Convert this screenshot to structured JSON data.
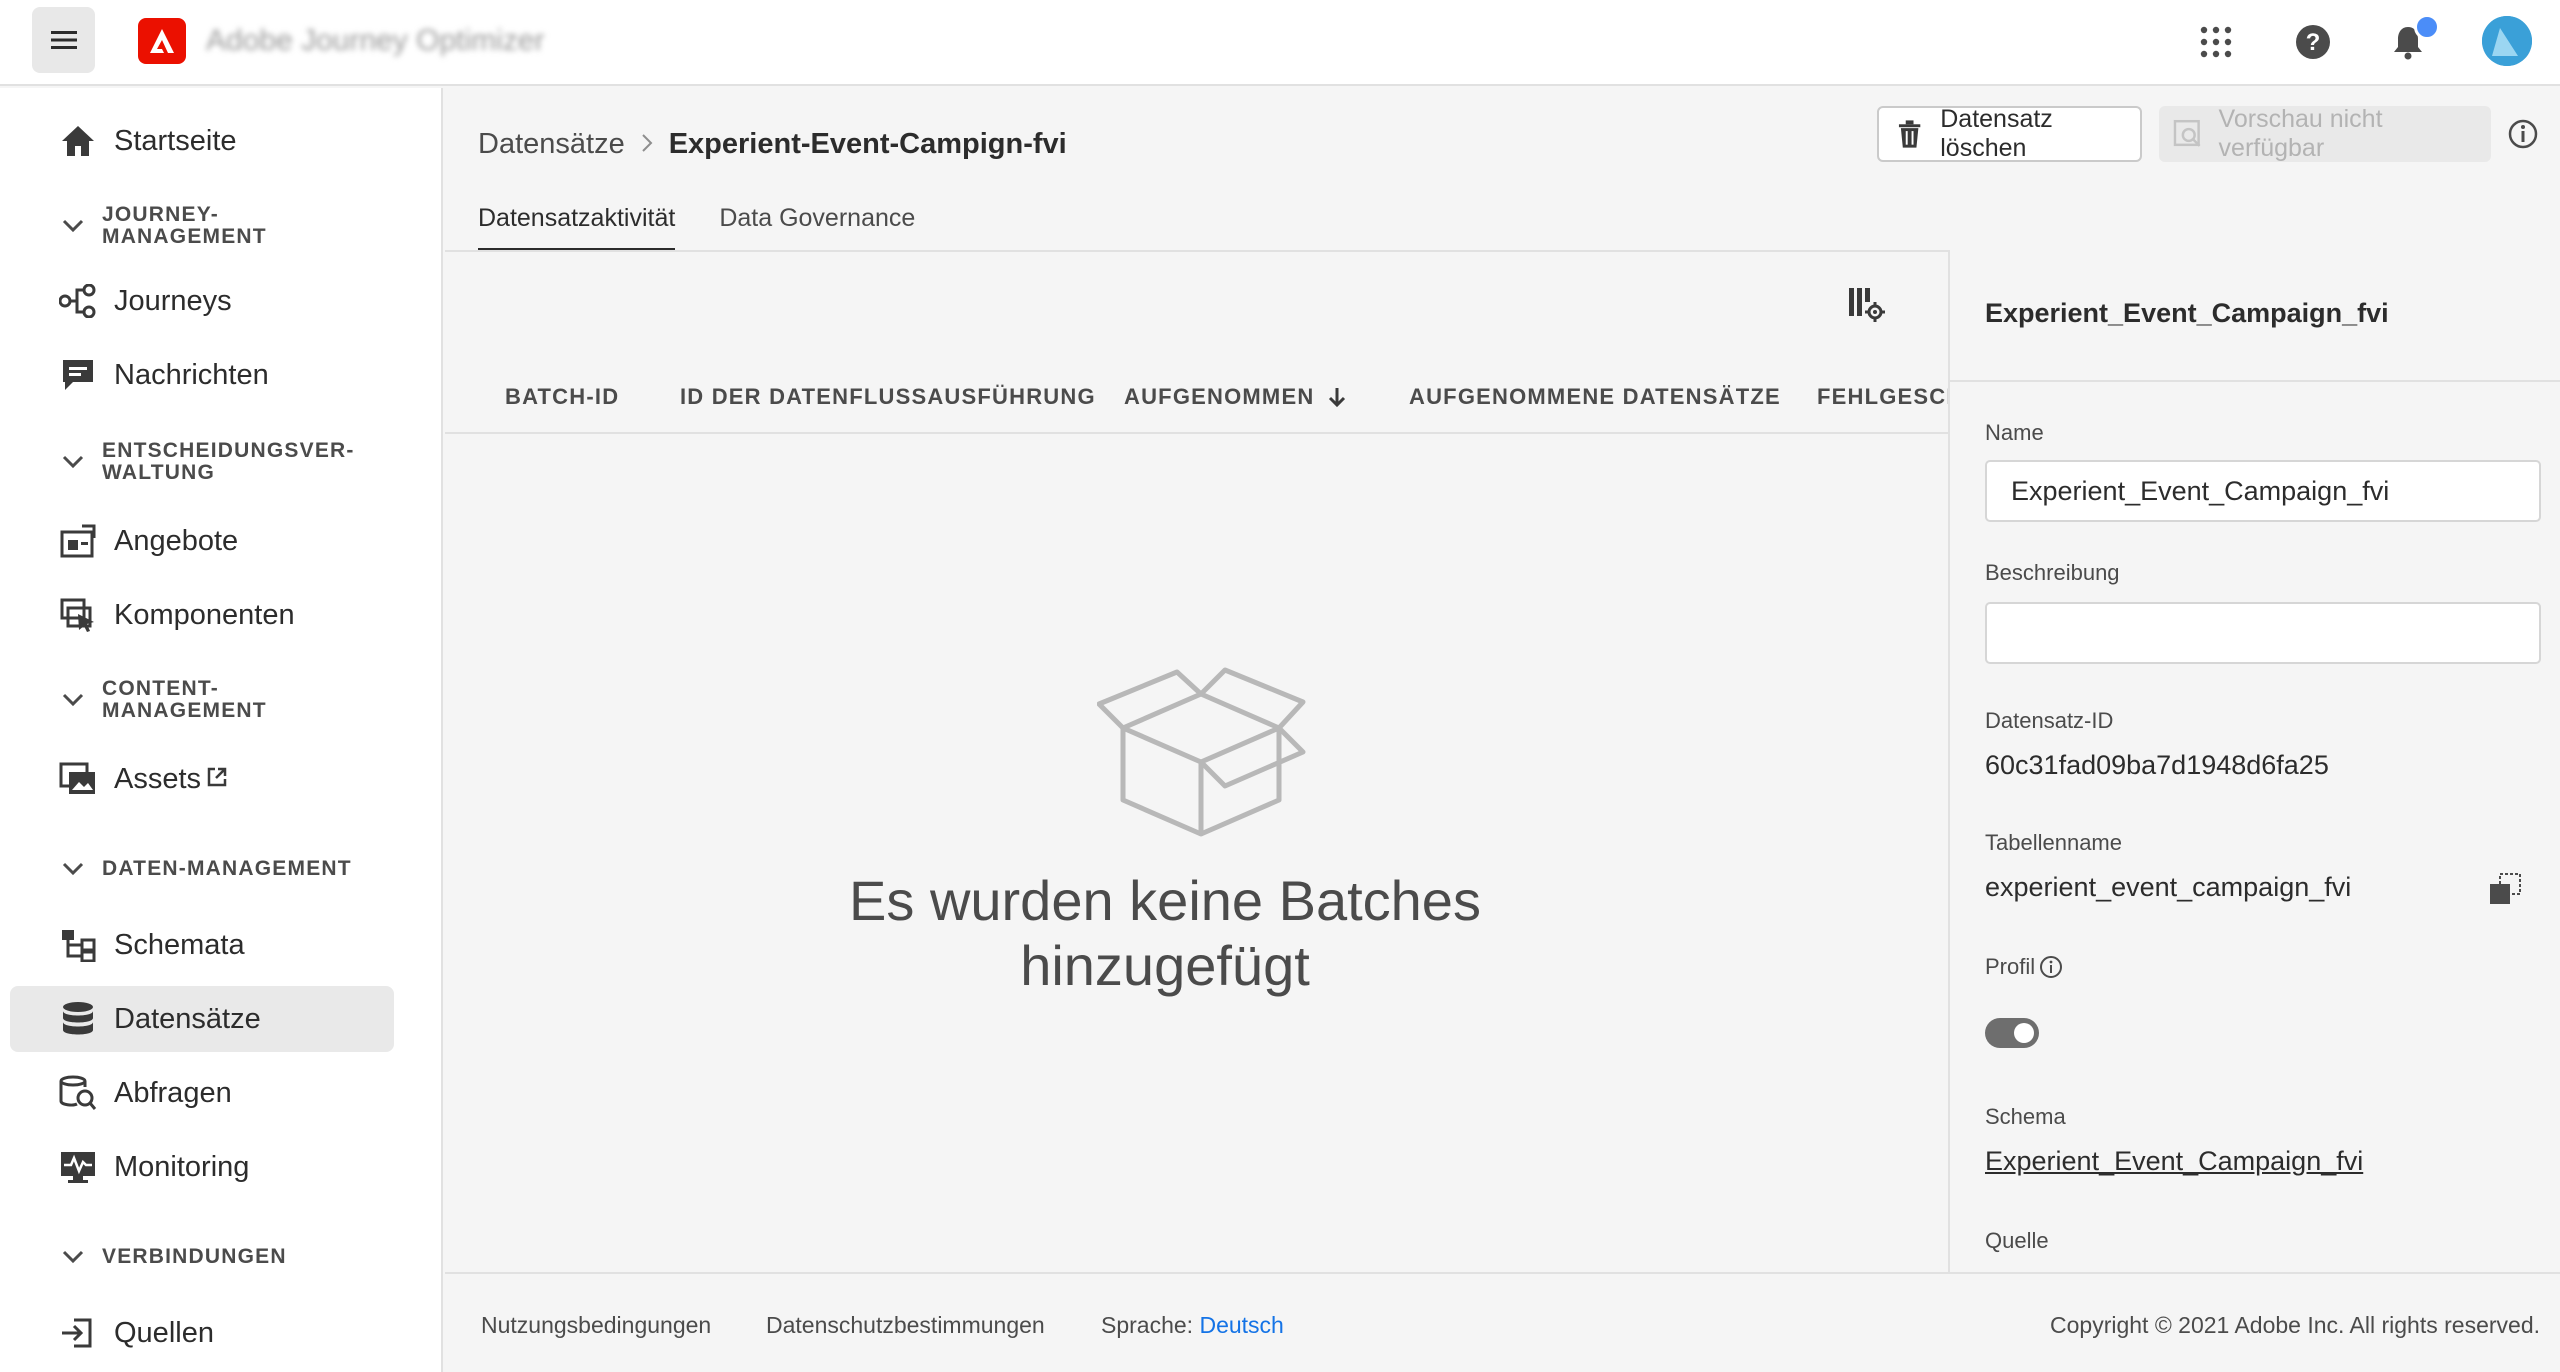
{
  "header": {
    "app_title": "Adobe Journey Optimizer",
    "icons": [
      "menu-icon",
      "adobe-logo-icon",
      "apps-grid-icon",
      "help-icon",
      "bell-icon",
      "avatar"
    ]
  },
  "sidebar": {
    "items": [
      {
        "label": "Startseite",
        "icon": "home-icon"
      },
      {
        "section": "JOURNEY-\nMANAGEMENT"
      },
      {
        "label": "Journeys",
        "icon": "journeys-icon"
      },
      {
        "label": "Nachrichten",
        "icon": "message-icon"
      },
      {
        "section": "ENTSCHEIDUNGSVER-\nWALTUNG"
      },
      {
        "label": "Angebote",
        "icon": "offers-icon"
      },
      {
        "label": "Komponenten",
        "icon": "components-icon"
      },
      {
        "section": "CONTENT-\nMANAGEMENT"
      },
      {
        "label": "Assets",
        "icon": "assets-icon"
      },
      {
        "section": "DATEN-MANAGEMENT"
      },
      {
        "label": "Schemata",
        "icon": "schema-icon"
      },
      {
        "label": "Datensätze",
        "icon": "datasets-icon",
        "active": true
      },
      {
        "label": "Abfragen",
        "icon": "queries-icon"
      },
      {
        "label": "Monitoring",
        "icon": "monitoring-icon"
      },
      {
        "section": "VERBINDUNGEN"
      },
      {
        "label": "Quellen",
        "icon": "sources-icon"
      }
    ],
    "journey_section_l1": "JOURNEY-",
    "journey_section_l2": "MANAGEMENT",
    "decision_section_l1": "ENTSCHEIDUNGSVER-",
    "decision_section_l2": "WALTUNG",
    "content_section_l1": "CONTENT-",
    "content_section_l2": "MANAGEMENT",
    "data_section": "DATEN-MANAGEMENT",
    "connections_section": "VERBINDUNGEN"
  },
  "breadcrumb": {
    "parent": "Datensätze",
    "current": "Experient-Event-Campign-fvi"
  },
  "actions": {
    "delete_label": "Datensatz löschen",
    "preview_label": "Vorschau nicht verfügbar"
  },
  "tabs": [
    {
      "label": "Datensatzaktivität",
      "active": true
    },
    {
      "label": "Data Governance",
      "active": false
    }
  ],
  "table": {
    "columns": [
      "BATCH-ID",
      "ID DER DATENFLUSSAUSFÜHRUNG",
      "AUFGENOMMEN",
      "AUFGENOMMENE DATENSÄTZE",
      "FEHLGESCH"
    ],
    "sorted_column": "AUFGENOMMEN",
    "empty_message": "Es wurden keine Batches hinzugefügt"
  },
  "panel": {
    "title": "Experient_Event_Campaign_fvi",
    "name_label": "Name",
    "name_value": "Experient_Event_Campaign_fvi",
    "description_label": "Beschreibung",
    "description_value": "",
    "dataset_id_label": "Datensatz-ID",
    "dataset_id_value": "60c31fad09ba7d1948d6fa25",
    "table_name_label": "Tabellenname",
    "table_name_value": "experient_event_campaign_fvi",
    "profile_label": "Profil",
    "profile_enabled": true,
    "schema_label": "Schema",
    "schema_value": "Experient_Event_Campaign_fvi",
    "source_label": "Quelle"
  },
  "footer": {
    "terms": "Nutzungsbedingungen",
    "privacy": "Datenschutzbestimmungen",
    "language_label": "Sprache:",
    "language_value": "Deutsch",
    "copyright": "Copyright ©  2021 Adobe Inc.  All rights reserved."
  },
  "colors": {
    "accent": "#1473e6",
    "adobe_red": "#eb1000",
    "notification": "#4b8df8"
  }
}
